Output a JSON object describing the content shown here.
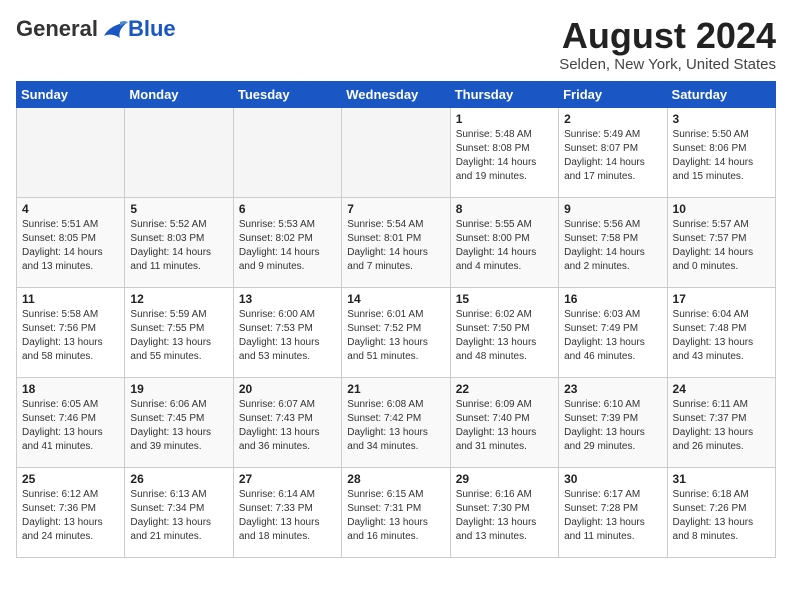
{
  "header": {
    "logo": {
      "general": "General",
      "blue": "Blue"
    },
    "title": "August 2024",
    "subtitle": "Selden, New York, United States"
  },
  "weekdays": [
    "Sunday",
    "Monday",
    "Tuesday",
    "Wednesday",
    "Thursday",
    "Friday",
    "Saturday"
  ],
  "weeks": [
    [
      {
        "day": "",
        "info": ""
      },
      {
        "day": "",
        "info": ""
      },
      {
        "day": "",
        "info": ""
      },
      {
        "day": "",
        "info": ""
      },
      {
        "day": "1",
        "info": "Sunrise: 5:48 AM\nSunset: 8:08 PM\nDaylight: 14 hours\nand 19 minutes."
      },
      {
        "day": "2",
        "info": "Sunrise: 5:49 AM\nSunset: 8:07 PM\nDaylight: 14 hours\nand 17 minutes."
      },
      {
        "day": "3",
        "info": "Sunrise: 5:50 AM\nSunset: 8:06 PM\nDaylight: 14 hours\nand 15 minutes."
      }
    ],
    [
      {
        "day": "4",
        "info": "Sunrise: 5:51 AM\nSunset: 8:05 PM\nDaylight: 14 hours\nand 13 minutes."
      },
      {
        "day": "5",
        "info": "Sunrise: 5:52 AM\nSunset: 8:03 PM\nDaylight: 14 hours\nand 11 minutes."
      },
      {
        "day": "6",
        "info": "Sunrise: 5:53 AM\nSunset: 8:02 PM\nDaylight: 14 hours\nand 9 minutes."
      },
      {
        "day": "7",
        "info": "Sunrise: 5:54 AM\nSunset: 8:01 PM\nDaylight: 14 hours\nand 7 minutes."
      },
      {
        "day": "8",
        "info": "Sunrise: 5:55 AM\nSunset: 8:00 PM\nDaylight: 14 hours\nand 4 minutes."
      },
      {
        "day": "9",
        "info": "Sunrise: 5:56 AM\nSunset: 7:58 PM\nDaylight: 14 hours\nand 2 minutes."
      },
      {
        "day": "10",
        "info": "Sunrise: 5:57 AM\nSunset: 7:57 PM\nDaylight: 14 hours\nand 0 minutes."
      }
    ],
    [
      {
        "day": "11",
        "info": "Sunrise: 5:58 AM\nSunset: 7:56 PM\nDaylight: 13 hours\nand 58 minutes."
      },
      {
        "day": "12",
        "info": "Sunrise: 5:59 AM\nSunset: 7:55 PM\nDaylight: 13 hours\nand 55 minutes."
      },
      {
        "day": "13",
        "info": "Sunrise: 6:00 AM\nSunset: 7:53 PM\nDaylight: 13 hours\nand 53 minutes."
      },
      {
        "day": "14",
        "info": "Sunrise: 6:01 AM\nSunset: 7:52 PM\nDaylight: 13 hours\nand 51 minutes."
      },
      {
        "day": "15",
        "info": "Sunrise: 6:02 AM\nSunset: 7:50 PM\nDaylight: 13 hours\nand 48 minutes."
      },
      {
        "day": "16",
        "info": "Sunrise: 6:03 AM\nSunset: 7:49 PM\nDaylight: 13 hours\nand 46 minutes."
      },
      {
        "day": "17",
        "info": "Sunrise: 6:04 AM\nSunset: 7:48 PM\nDaylight: 13 hours\nand 43 minutes."
      }
    ],
    [
      {
        "day": "18",
        "info": "Sunrise: 6:05 AM\nSunset: 7:46 PM\nDaylight: 13 hours\nand 41 minutes."
      },
      {
        "day": "19",
        "info": "Sunrise: 6:06 AM\nSunset: 7:45 PM\nDaylight: 13 hours\nand 39 minutes."
      },
      {
        "day": "20",
        "info": "Sunrise: 6:07 AM\nSunset: 7:43 PM\nDaylight: 13 hours\nand 36 minutes."
      },
      {
        "day": "21",
        "info": "Sunrise: 6:08 AM\nSunset: 7:42 PM\nDaylight: 13 hours\nand 34 minutes."
      },
      {
        "day": "22",
        "info": "Sunrise: 6:09 AM\nSunset: 7:40 PM\nDaylight: 13 hours\nand 31 minutes."
      },
      {
        "day": "23",
        "info": "Sunrise: 6:10 AM\nSunset: 7:39 PM\nDaylight: 13 hours\nand 29 minutes."
      },
      {
        "day": "24",
        "info": "Sunrise: 6:11 AM\nSunset: 7:37 PM\nDaylight: 13 hours\nand 26 minutes."
      }
    ],
    [
      {
        "day": "25",
        "info": "Sunrise: 6:12 AM\nSunset: 7:36 PM\nDaylight: 13 hours\nand 24 minutes."
      },
      {
        "day": "26",
        "info": "Sunrise: 6:13 AM\nSunset: 7:34 PM\nDaylight: 13 hours\nand 21 minutes."
      },
      {
        "day": "27",
        "info": "Sunrise: 6:14 AM\nSunset: 7:33 PM\nDaylight: 13 hours\nand 18 minutes."
      },
      {
        "day": "28",
        "info": "Sunrise: 6:15 AM\nSunset: 7:31 PM\nDaylight: 13 hours\nand 16 minutes."
      },
      {
        "day": "29",
        "info": "Sunrise: 6:16 AM\nSunset: 7:30 PM\nDaylight: 13 hours\nand 13 minutes."
      },
      {
        "day": "30",
        "info": "Sunrise: 6:17 AM\nSunset: 7:28 PM\nDaylight: 13 hours\nand 11 minutes."
      },
      {
        "day": "31",
        "info": "Sunrise: 6:18 AM\nSunset: 7:26 PM\nDaylight: 13 hours\nand 8 minutes."
      }
    ]
  ]
}
